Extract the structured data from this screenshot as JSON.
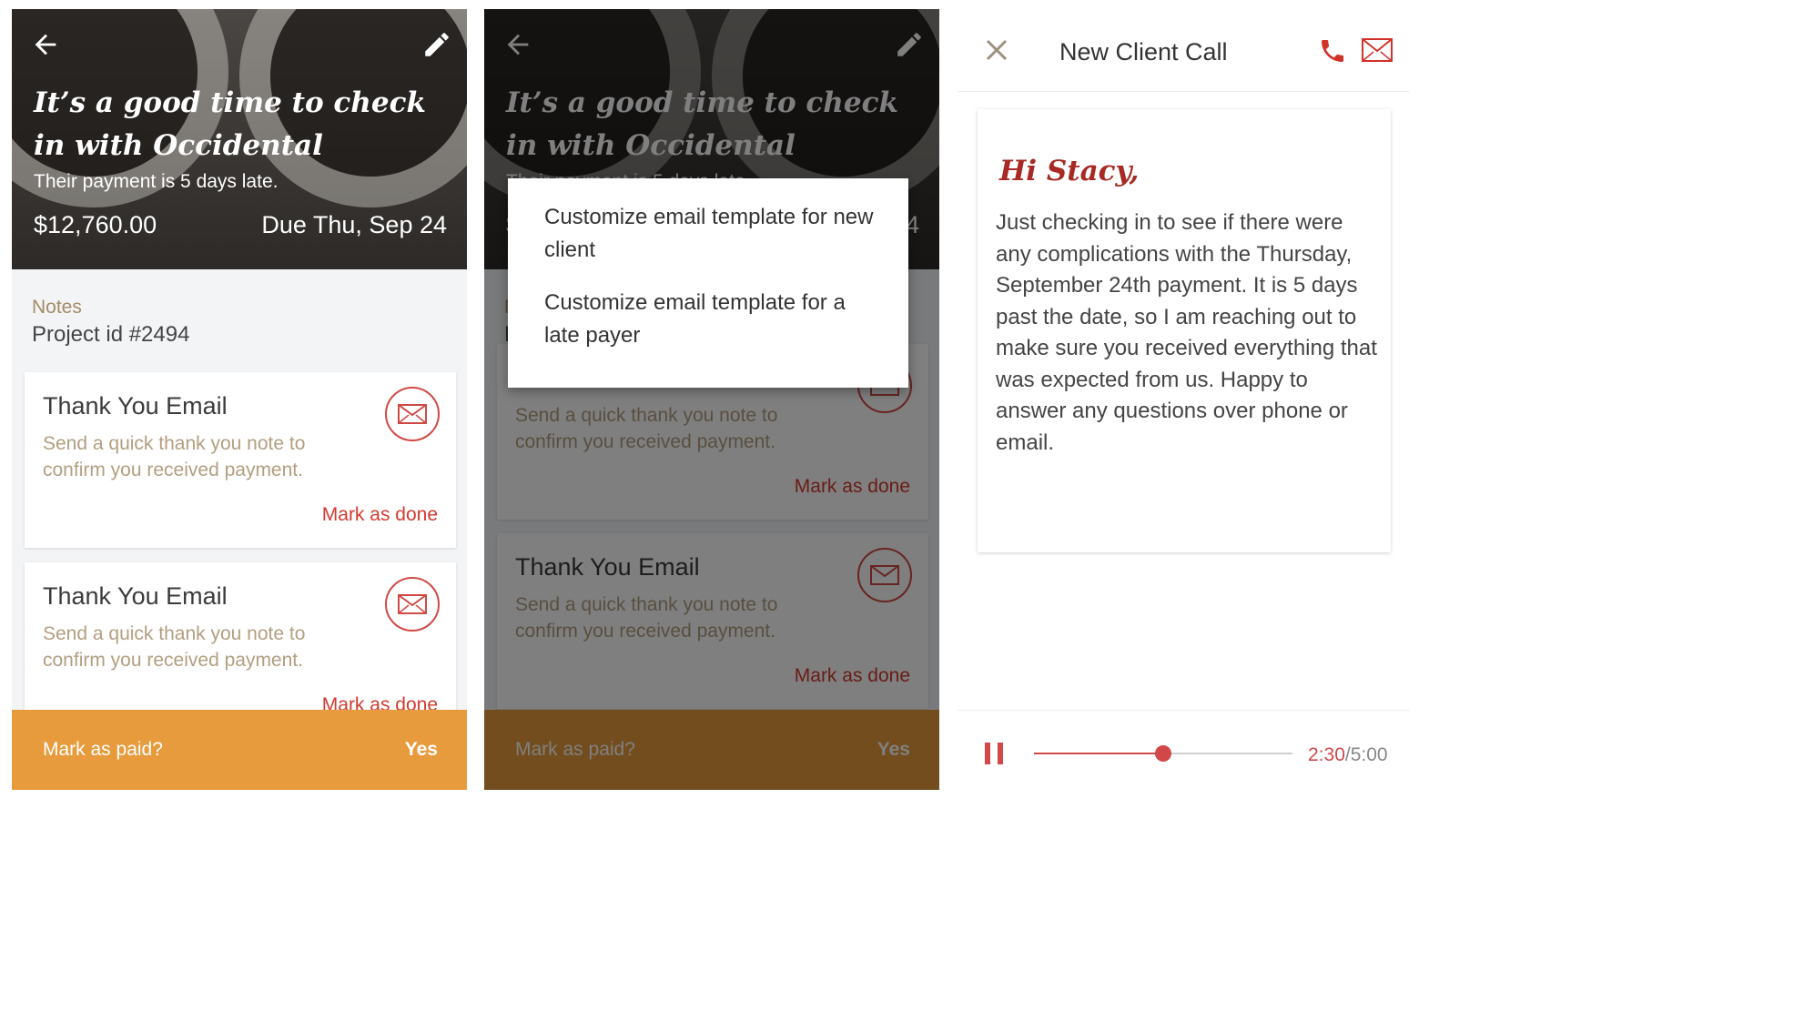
{
  "colors": {
    "accent": "#d3392f",
    "bar": "#e79b3c",
    "notes_label": "#a48b67"
  },
  "hero": {
    "title": "It’s a good time to check in with Occidental",
    "subtitle": "Their payment is 5 days late.",
    "amount": "$12,760.00",
    "due": "Due Thu, Sep 24",
    "back_icon": "arrow-left-icon",
    "edit_icon": "pencil-icon"
  },
  "notes": {
    "label": "Notes",
    "value": "Project id #2494"
  },
  "cards": [
    {
      "title": "Thank You Email",
      "desc": "Send a quick thank you note to confirm you received payment.",
      "done": "Mark as done"
    },
    {
      "title": "Thank You Email",
      "desc": "Send a quick thank you note to confirm you received payment.",
      "done": "Mark as done"
    }
  ],
  "bottom": {
    "question": "Mark as paid?",
    "yes": "Yes"
  },
  "menu": {
    "items": [
      "Customize email template for new client",
      "Customize email template for a late payer"
    ]
  },
  "call": {
    "title": "New Client Call",
    "greeting": "Hi Stacy,",
    "body": "Just checking in to see if there were any complications with the Thursday, September 24th payment.  It is 5 days past the date, so I am reaching out to make sure you received everything that was expected from us. Happy to answer any questions over phone or email.",
    "elapsed": "2:30",
    "total": "/5:00",
    "progress": 0.5
  }
}
